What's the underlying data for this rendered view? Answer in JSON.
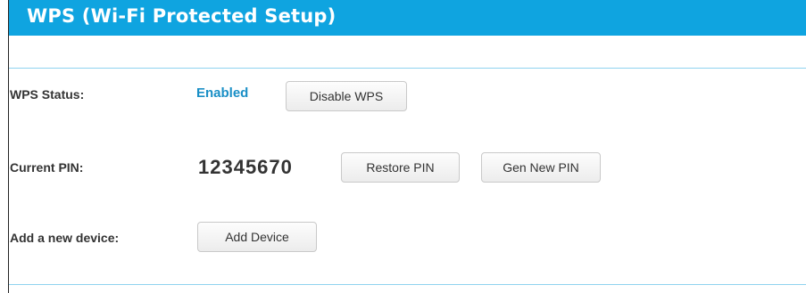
{
  "header": {
    "title": "WPS (Wi-Fi Protected Setup)"
  },
  "wps_status": {
    "label": "WPS Status:",
    "value": "Enabled",
    "button_label": "Disable WPS"
  },
  "current_pin": {
    "label": "Current PIN:",
    "value": "12345670",
    "restore_label": "Restore PIN",
    "gen_label": "Gen New PIN"
  },
  "add_device": {
    "label": "Add a new device:",
    "button_label": "Add Device"
  },
  "colors": {
    "header_bg": "#0fa4e0",
    "status_text": "#1a8fc6",
    "divider": "#8fd3ef"
  }
}
